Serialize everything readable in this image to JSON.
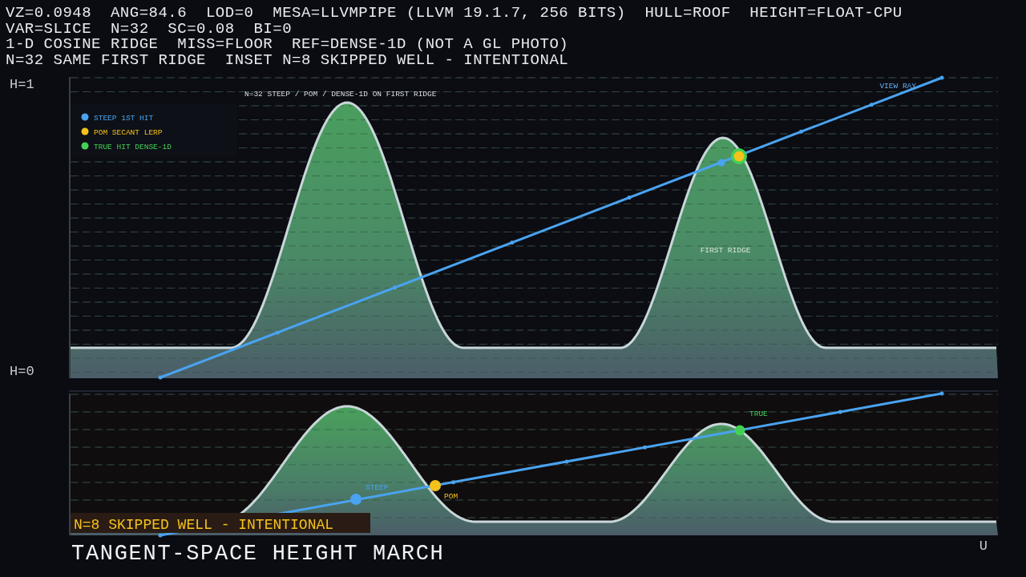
{
  "header_lines": [
    "VZ=0.0948  ANG=84.6  LOD=0  MESA=LLVMPIPE (LLVM 19.1.7, 256 BITS)  HULL=ROOF  HEIGHT=FLOAT-CPU",
    "VAR=SLICE  N=32  SC=0.08  BI=0",
    "1-D COSINE RIDGE  MISS=FLOOR  REF=DENSE-1D (NOT A GL PHOTO)",
    "N=32 SAME FIRST RIDGE  INSET N=8 SKIPPED WELL - INTENTIONAL"
  ],
  "main_panel": {
    "y_labels": [
      "H=1",
      "H=0"
    ],
    "caption": "N=32  STEEP / POM / DENSE-1D ON FIRST RIDGE",
    "legend": [
      {
        "label": "STEEP 1ST HIT",
        "color": "#4aa3f0"
      },
      {
        "label": "POM SECANT LERP",
        "color": "#f5c21b"
      },
      {
        "label": "TRUE HIT DENSE-1D",
        "color": "#44d056"
      }
    ],
    "ray_label": "VIEW RAY",
    "ridge_label": "FIRST RIDGE"
  },
  "inset": {
    "markers": [
      {
        "label": "STEEP",
        "color": "#4aa3f0"
      },
      {
        "label": "POM",
        "color": "#f5c21b"
      },
      {
        "label": "TRUE",
        "color": "#44d056"
      }
    ],
    "banner": "N=8 SKIPPED WELL - INTENTIONAL"
  },
  "title": "TANGENT-SPACE HEIGHT MARCH",
  "axis_label": "U"
}
